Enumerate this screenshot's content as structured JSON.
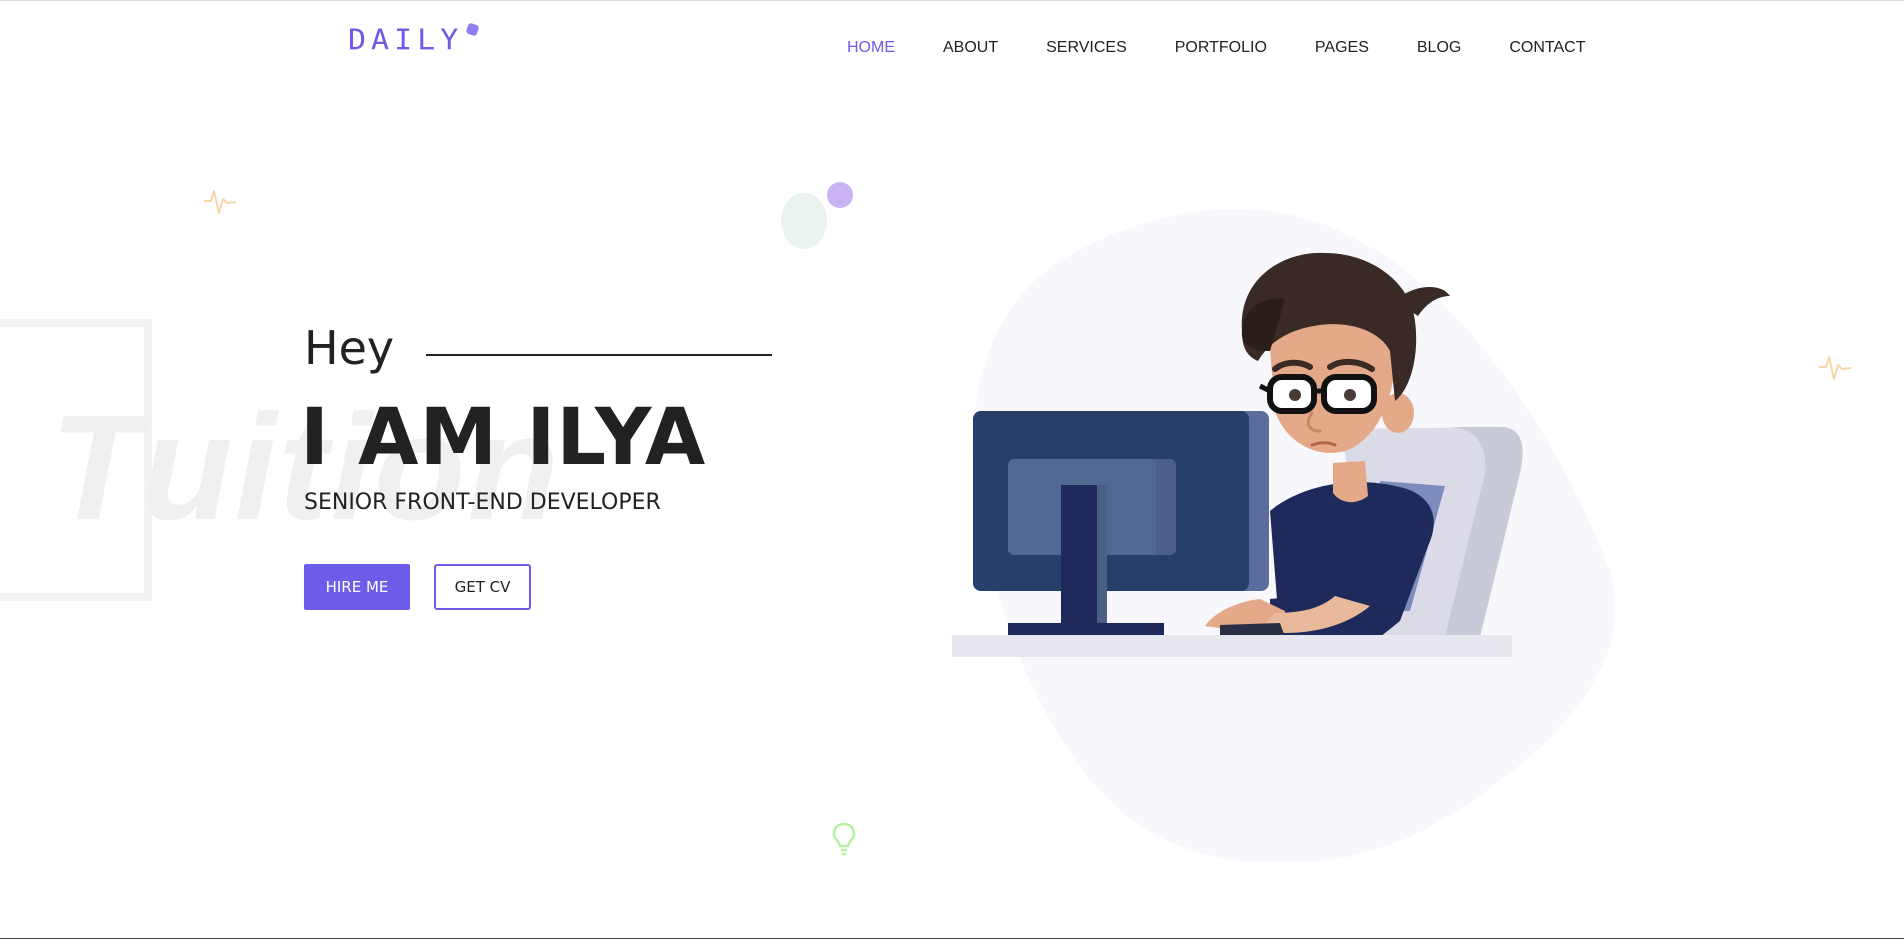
{
  "header": {
    "logo_text": "DAILY",
    "nav": [
      {
        "label": "HOME",
        "active": true
      },
      {
        "label": "ABOUT",
        "active": false
      },
      {
        "label": "SERVICES",
        "active": false
      },
      {
        "label": "PORTFOLIO",
        "active": false
      },
      {
        "label": "PAGES",
        "active": false
      },
      {
        "label": "BLOG",
        "active": false
      },
      {
        "label": "CONTACT",
        "active": false
      }
    ]
  },
  "hero": {
    "greeting": "Hey",
    "name": "I AM ILYA",
    "role": "SENIOR FRONT-END DEVELOPER",
    "hire_label": "HIRE ME",
    "cv_label": "GET CV",
    "watermark_text": "Tuition"
  },
  "colors": {
    "accent": "#6c5ce7",
    "text": "#222222",
    "blob": "#f7f7fc",
    "pulse": "#f5d8a8",
    "bulb": "#b9efa0"
  },
  "icons": [
    "pulse-icon",
    "lightbulb-icon",
    "developer-illustration"
  ]
}
